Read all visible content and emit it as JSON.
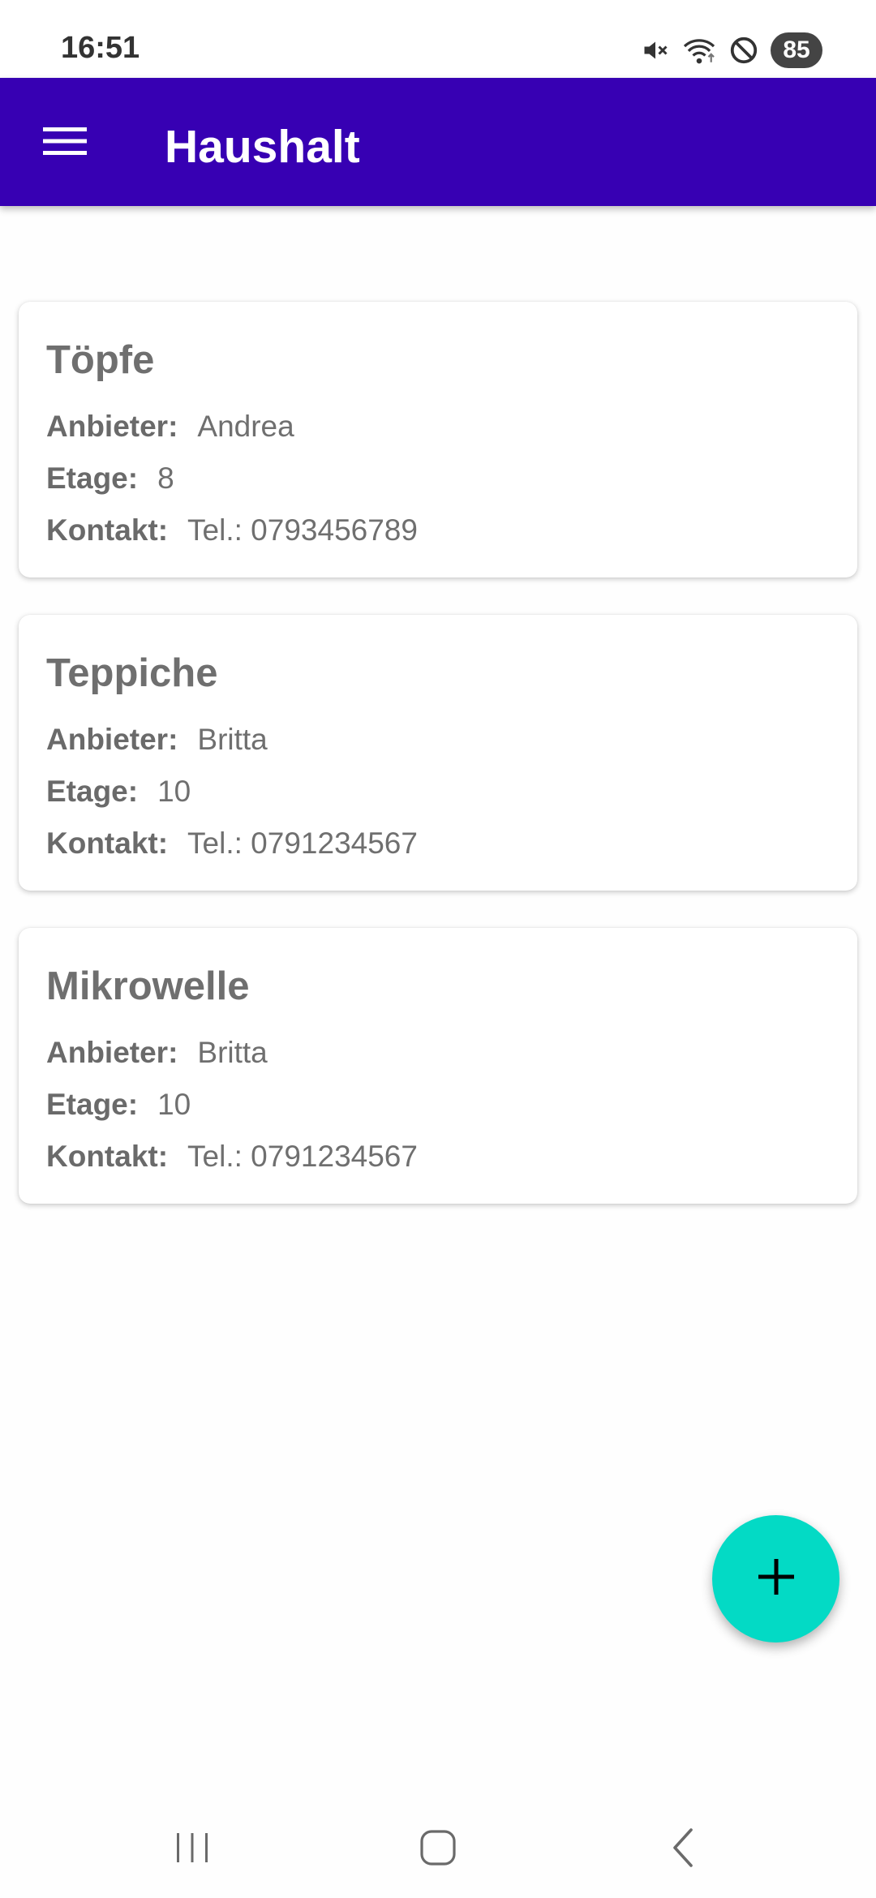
{
  "status_bar": {
    "time": "16:51",
    "battery": "85",
    "icons": [
      "mute-icon",
      "wifi-icon",
      "do-not-disturb-icon",
      "battery-icon"
    ]
  },
  "app_bar": {
    "title": "Haushalt",
    "background": "#3700b3",
    "menu_icon": "hamburger-menu-icon"
  },
  "labels": {
    "provider": "Anbieter:",
    "floor": "Etage:",
    "contact": "Kontakt:"
  },
  "items": [
    {
      "title": "Töpfe",
      "provider": "Andrea",
      "floor": "8",
      "contact": "Tel.: 0793456789"
    },
    {
      "title": "Teppiche",
      "provider": "Britta",
      "floor": "10",
      "contact": "Tel.: 0791234567"
    },
    {
      "title": "Mikrowelle",
      "provider": "Britta",
      "floor": "10",
      "contact": "Tel.: 0791234567"
    }
  ],
  "fab": {
    "icon": "plus-icon",
    "color": "#03dac5"
  },
  "nav_bar": {
    "icons": [
      "recent-apps-icon",
      "home-icon",
      "back-icon"
    ]
  }
}
